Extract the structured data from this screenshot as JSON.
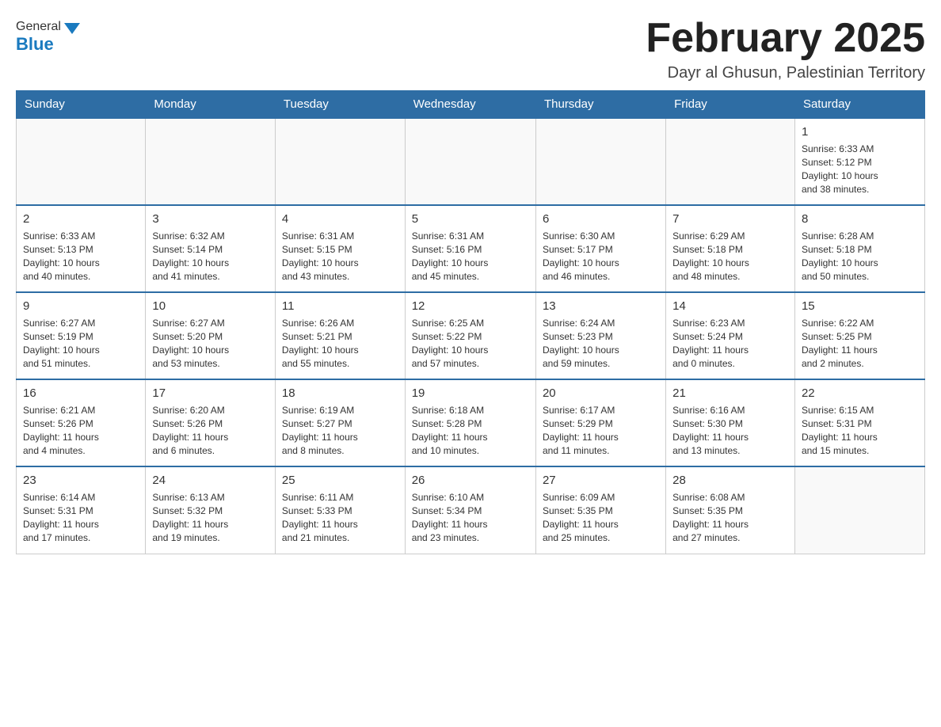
{
  "header": {
    "title": "February 2025",
    "location": "Dayr al Ghusun, Palestinian Territory",
    "logo_general": "General",
    "logo_blue": "Blue"
  },
  "weekdays": [
    "Sunday",
    "Monday",
    "Tuesday",
    "Wednesday",
    "Thursday",
    "Friday",
    "Saturday"
  ],
  "rows": [
    [
      {
        "day": "",
        "info": ""
      },
      {
        "day": "",
        "info": ""
      },
      {
        "day": "",
        "info": ""
      },
      {
        "day": "",
        "info": ""
      },
      {
        "day": "",
        "info": ""
      },
      {
        "day": "",
        "info": ""
      },
      {
        "day": "1",
        "info": "Sunrise: 6:33 AM\nSunset: 5:12 PM\nDaylight: 10 hours\nand 38 minutes."
      }
    ],
    [
      {
        "day": "2",
        "info": "Sunrise: 6:33 AM\nSunset: 5:13 PM\nDaylight: 10 hours\nand 40 minutes."
      },
      {
        "day": "3",
        "info": "Sunrise: 6:32 AM\nSunset: 5:14 PM\nDaylight: 10 hours\nand 41 minutes."
      },
      {
        "day": "4",
        "info": "Sunrise: 6:31 AM\nSunset: 5:15 PM\nDaylight: 10 hours\nand 43 minutes."
      },
      {
        "day": "5",
        "info": "Sunrise: 6:31 AM\nSunset: 5:16 PM\nDaylight: 10 hours\nand 45 minutes."
      },
      {
        "day": "6",
        "info": "Sunrise: 6:30 AM\nSunset: 5:17 PM\nDaylight: 10 hours\nand 46 minutes."
      },
      {
        "day": "7",
        "info": "Sunrise: 6:29 AM\nSunset: 5:18 PM\nDaylight: 10 hours\nand 48 minutes."
      },
      {
        "day": "8",
        "info": "Sunrise: 6:28 AM\nSunset: 5:18 PM\nDaylight: 10 hours\nand 50 minutes."
      }
    ],
    [
      {
        "day": "9",
        "info": "Sunrise: 6:27 AM\nSunset: 5:19 PM\nDaylight: 10 hours\nand 51 minutes."
      },
      {
        "day": "10",
        "info": "Sunrise: 6:27 AM\nSunset: 5:20 PM\nDaylight: 10 hours\nand 53 minutes."
      },
      {
        "day": "11",
        "info": "Sunrise: 6:26 AM\nSunset: 5:21 PM\nDaylight: 10 hours\nand 55 minutes."
      },
      {
        "day": "12",
        "info": "Sunrise: 6:25 AM\nSunset: 5:22 PM\nDaylight: 10 hours\nand 57 minutes."
      },
      {
        "day": "13",
        "info": "Sunrise: 6:24 AM\nSunset: 5:23 PM\nDaylight: 10 hours\nand 59 minutes."
      },
      {
        "day": "14",
        "info": "Sunrise: 6:23 AM\nSunset: 5:24 PM\nDaylight: 11 hours\nand 0 minutes."
      },
      {
        "day": "15",
        "info": "Sunrise: 6:22 AM\nSunset: 5:25 PM\nDaylight: 11 hours\nand 2 minutes."
      }
    ],
    [
      {
        "day": "16",
        "info": "Sunrise: 6:21 AM\nSunset: 5:26 PM\nDaylight: 11 hours\nand 4 minutes."
      },
      {
        "day": "17",
        "info": "Sunrise: 6:20 AM\nSunset: 5:26 PM\nDaylight: 11 hours\nand 6 minutes."
      },
      {
        "day": "18",
        "info": "Sunrise: 6:19 AM\nSunset: 5:27 PM\nDaylight: 11 hours\nand 8 minutes."
      },
      {
        "day": "19",
        "info": "Sunrise: 6:18 AM\nSunset: 5:28 PM\nDaylight: 11 hours\nand 10 minutes."
      },
      {
        "day": "20",
        "info": "Sunrise: 6:17 AM\nSunset: 5:29 PM\nDaylight: 11 hours\nand 11 minutes."
      },
      {
        "day": "21",
        "info": "Sunrise: 6:16 AM\nSunset: 5:30 PM\nDaylight: 11 hours\nand 13 minutes."
      },
      {
        "day": "22",
        "info": "Sunrise: 6:15 AM\nSunset: 5:31 PM\nDaylight: 11 hours\nand 15 minutes."
      }
    ],
    [
      {
        "day": "23",
        "info": "Sunrise: 6:14 AM\nSunset: 5:31 PM\nDaylight: 11 hours\nand 17 minutes."
      },
      {
        "day": "24",
        "info": "Sunrise: 6:13 AM\nSunset: 5:32 PM\nDaylight: 11 hours\nand 19 minutes."
      },
      {
        "day": "25",
        "info": "Sunrise: 6:11 AM\nSunset: 5:33 PM\nDaylight: 11 hours\nand 21 minutes."
      },
      {
        "day": "26",
        "info": "Sunrise: 6:10 AM\nSunset: 5:34 PM\nDaylight: 11 hours\nand 23 minutes."
      },
      {
        "day": "27",
        "info": "Sunrise: 6:09 AM\nSunset: 5:35 PM\nDaylight: 11 hours\nand 25 minutes."
      },
      {
        "day": "28",
        "info": "Sunrise: 6:08 AM\nSunset: 5:35 PM\nDaylight: 11 hours\nand 27 minutes."
      },
      {
        "day": "",
        "info": ""
      }
    ]
  ]
}
